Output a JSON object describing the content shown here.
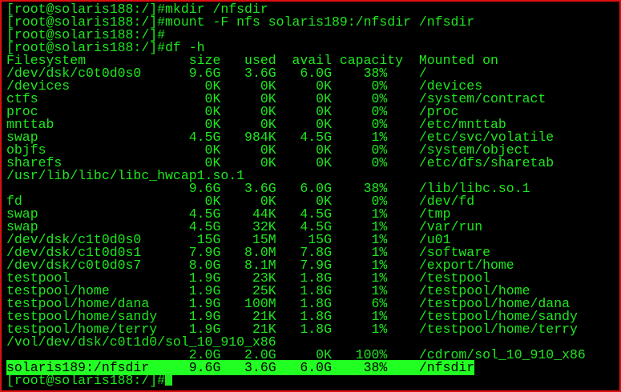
{
  "terminal": {
    "lines": [
      "[root@solaris188:/]#mkdir /nfsdir",
      "[root@solaris188:/]#mount -F nfs solaris189:/nfsdir /nfsdir",
      "[root@solaris188:/]#",
      "[root@solaris188:/]#df -h",
      "Filesystem             size   used  avail capacity  Mounted on",
      "/dev/dsk/c0t0d0s0      9.6G   3.6G   6.0G    38%    /",
      "/devices                 0K     0K     0K     0%    /devices",
      "ctfs                     0K     0K     0K     0%    /system/contract",
      "proc                     0K     0K     0K     0%    /proc",
      "mnttab                   0K     0K     0K     0%    /etc/mnttab",
      "swap                   4.5G   984K   4.5G     1%    /etc/svc/volatile",
      "objfs                    0K     0K     0K     0%    /system/object",
      "sharefs                  0K     0K     0K     0%    /etc/dfs/sharetab",
      "/usr/lib/libc/libc_hwcap1.so.1",
      "                       9.6G   3.6G   6.0G    38%    /lib/libc.so.1",
      "fd                       0K     0K     0K     0%    /dev/fd",
      "swap                   4.5G    44K   4.5G     1%    /tmp",
      "swap                   4.5G    32K   4.5G     1%    /var/run",
      "/dev/dsk/c1t0d0s0       15G    15M    15G     1%    /u01",
      "/dev/dsk/c1t0d0s1      7.9G   8.0M   7.8G     1%    /software",
      "/dev/dsk/c0t0d0s7      8.0G   8.1M   7.9G     1%    /export/home",
      "testpool               1.9G    23K   1.8G     1%    /testpool",
      "testpool/home          1.9G    25K   1.8G     1%    /testpool/home",
      "testpool/home/dana     1.9G   100M   1.8G     6%    /testpool/home/dana",
      "testpool/home/sandy    1.9G    21K   1.8G     1%    /testpool/home/sandy",
      "testpool/home/terry    1.9G    21K   1.8G     1%    /testpool/home/terry",
      "/vol/dev/dsk/c0t1d0/sol_10_910_x86",
      "                       2.0G   2.0G     0K   100%    /cdrom/sol_10_910_x86",
      "solaris189:/nfsdir     9.6G   3.6G   6.0G    38%    /nfsdir",
      "[root@solaris188:/]#"
    ],
    "highlighted_line": 28,
    "colors": {
      "text": "#1ee81e",
      "highlight": "#22ff22",
      "background": "#000000",
      "border": "#e01010"
    }
  }
}
